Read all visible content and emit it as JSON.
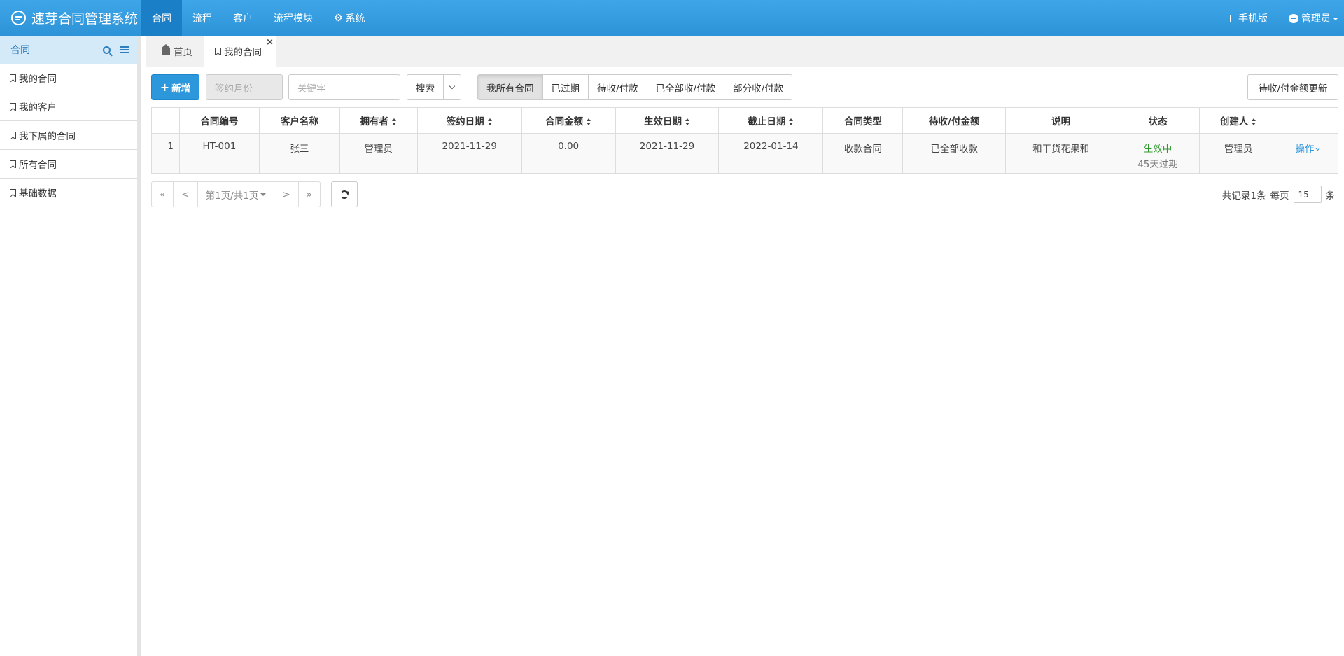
{
  "app": {
    "title": "速芽合同管理系统"
  },
  "topnav": {
    "items": [
      {
        "label": "合同"
      },
      {
        "label": "流程"
      },
      {
        "label": "客户"
      },
      {
        "label": "流程模块"
      },
      {
        "label": "系统"
      }
    ],
    "mobile_label": "手机版",
    "user_label": "管理员"
  },
  "sidebar": {
    "title": "合同",
    "items": [
      {
        "label": "我的合同"
      },
      {
        "label": "我的客户"
      },
      {
        "label": "我下属的合同"
      },
      {
        "label": "所有合同"
      },
      {
        "label": "基础数据"
      }
    ]
  },
  "tabs": [
    {
      "label": "首页"
    },
    {
      "label": "我的合同"
    }
  ],
  "toolbar": {
    "add_label": "新增",
    "month_placeholder": "签约月份",
    "keyword_placeholder": "关键字",
    "search_label": "搜索",
    "filters": [
      "我所有合同",
      "已过期",
      "待收/付款",
      "已全部收/付款",
      "部分收/付款"
    ],
    "update_label": "待收/付金额更新"
  },
  "table": {
    "headers": [
      "",
      "合同编号",
      "客户名称",
      "拥有者",
      "签约日期",
      "合同金额",
      "生效日期",
      "截止日期",
      "合同类型",
      "待收/付金额",
      "说明",
      "状态",
      "创建人",
      ""
    ],
    "rows": [
      {
        "index": "1",
        "number": "HT-001",
        "customer": "张三",
        "owner": "管理员",
        "sign_date": "2021-11-29",
        "amount": "0.00",
        "effective_date": "2021-11-29",
        "end_date": "2022-01-14",
        "type": "收款合同",
        "pending": "已全部收款",
        "note": "和干货花果和",
        "status": "生效中",
        "status_sub": "45天过期",
        "creator": "管理员",
        "action": "操作"
      }
    ]
  },
  "pager": {
    "first": "«",
    "prev": "<",
    "page_label": "第1页/共1页",
    "next": ">",
    "last": "»",
    "total_label": "共记录1条",
    "per_page_label": "每页",
    "per_page_value": "15",
    "unit_label": "条"
  },
  "colors": {
    "brand": "#2d93d8",
    "accent": "#2d97dc",
    "success": "#2e9a2e"
  }
}
